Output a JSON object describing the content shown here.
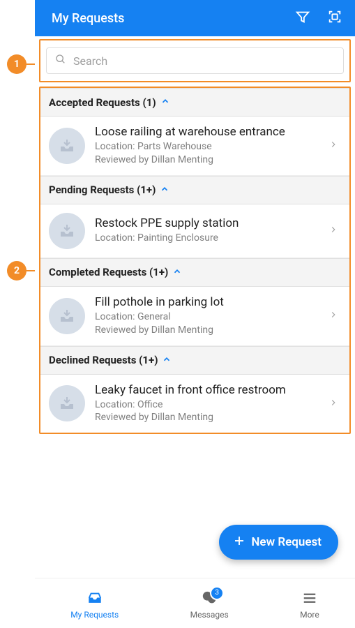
{
  "header": {
    "title": "My Requests"
  },
  "search": {
    "placeholder": "Search"
  },
  "sections": [
    {
      "header": "Accepted Requests (1)",
      "items": [
        {
          "title": "Loose railing at warehouse entrance",
          "location": "Location: Parts Warehouse",
          "reviewed": "Reviewed by Dillan Menting"
        }
      ]
    },
    {
      "header": "Pending Requests (1+)",
      "items": [
        {
          "title": "Restock PPE supply station",
          "location": "Location: Painting Enclosure",
          "reviewed": ""
        }
      ]
    },
    {
      "header": "Completed Requests (1+)",
      "items": [
        {
          "title": "Fill pothole in parking lot",
          "location": "Location: General",
          "reviewed": "Reviewed by Dillan Menting"
        }
      ]
    },
    {
      "header": "Declined Requests (1+)",
      "items": [
        {
          "title": "Leaky faucet in front office restroom",
          "location": "Location: Office",
          "reviewed": "Reviewed by Dillan Menting"
        }
      ]
    }
  ],
  "fab": {
    "label": "New Request"
  },
  "nav": {
    "my_requests": "My Requests",
    "messages": "Messages",
    "messages_badge": "3",
    "more": "More"
  },
  "annotations": {
    "one": "1",
    "two": "2"
  }
}
